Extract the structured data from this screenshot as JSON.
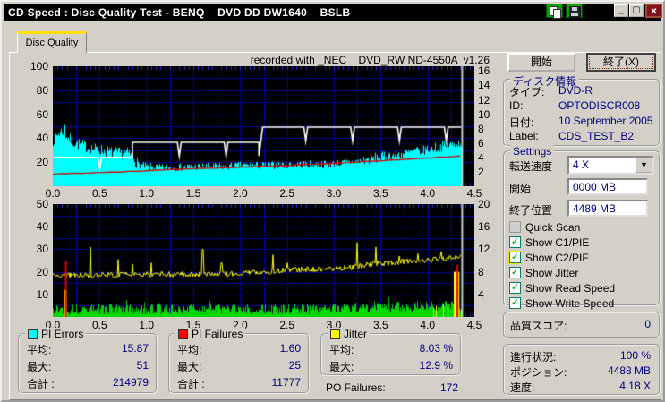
{
  "window": {
    "title": "CD Speed : Disc Quality Test - BENQ    DVD DD DW1640    BSLB",
    "minimize": "_",
    "maximize": "▢",
    "close": "×"
  },
  "tab": {
    "label": "Disc Quality"
  },
  "header": {
    "recorded_with": "recorded with _NEC    DVD_RW ND-4550A  v1.26"
  },
  "chart_data": [
    {
      "type": "area",
      "name": "pi-errors-and-speed-chart",
      "x_axis": {
        "range": [
          0,
          4.5
        ],
        "ticks": [
          "0.0",
          "0.5",
          "1.0",
          "1.5",
          "2.0",
          "2.5",
          "3.0",
          "3.5",
          "4.0",
          "4.5"
        ]
      },
      "y_left": {
        "range": [
          0,
          100
        ],
        "ticks": [
          100,
          80,
          60,
          40,
          20
        ]
      },
      "y_right": {
        "range": [
          0,
          16.67
        ],
        "ticks": [
          16,
          14,
          12,
          10,
          8,
          6,
          4,
          2
        ],
        "left_units_per_right_unit": 6
      },
      "data_end_x": 4.36,
      "grid": {
        "color": "#0000a0",
        "x_step": 0.25,
        "y_step_left": 10
      },
      "series": [
        {
          "name": "PI Errors",
          "color": "#00ffff",
          "style": "filled-spiky-area",
          "avg": 15.87,
          "max": 51,
          "total": 214979,
          "envelope": [
            [
              0,
              38
            ],
            [
              0.05,
              43
            ],
            [
              0.1,
              46
            ],
            [
              0.15,
              41
            ],
            [
              0.2,
              37
            ],
            [
              0.3,
              34
            ],
            [
              0.4,
              31
            ],
            [
              0.5,
              30
            ],
            [
              0.6,
              28
            ],
            [
              0.7,
              27
            ],
            [
              0.8,
              27
            ],
            [
              0.85,
              25
            ],
            [
              0.9,
              18
            ],
            [
              1,
              16
            ],
            [
              1.2,
              15
            ],
            [
              1.5,
              16
            ],
            [
              1.8,
              16
            ],
            [
              2,
              17
            ],
            [
              2.3,
              17
            ],
            [
              2.6,
              18
            ],
            [
              2.9,
              18
            ],
            [
              3.1,
              19
            ],
            [
              3.3,
              21
            ],
            [
              3.5,
              24
            ],
            [
              3.7,
              26
            ],
            [
              3.9,
              29
            ],
            [
              4.1,
              32
            ],
            [
              4.25,
              34
            ],
            [
              4.36,
              36
            ]
          ],
          "max_spike": {
            "x": 0.12,
            "value": 51
          }
        },
        {
          "name": "Write Speed",
          "color": "#ffffff",
          "style": "step-line",
          "unit": "X",
          "segments": [
            {
              "from": 0,
              "to": 0.85,
              "speed_x": 4
            },
            {
              "from": 0.85,
              "to": 2.2,
              "speed_x": 6.1
            },
            {
              "from": 2.2,
              "to": 4.36,
              "speed_x": 8.2
            }
          ],
          "notches": [
            {
              "x": 0.5,
              "dip_to": 2.5
            },
            {
              "x": 1.35,
              "dip_to": 4.2
            },
            {
              "x": 1.85,
              "dip_to": 4.2
            },
            {
              "x": 2.2,
              "dip_to": 4.2
            },
            {
              "x": 2.7,
              "dip_to": 6.3
            },
            {
              "x": 3.2,
              "dip_to": 6.3
            },
            {
              "x": 3.7,
              "dip_to": 6.3
            },
            {
              "x": 4.2,
              "dip_to": 6.3
            }
          ]
        },
        {
          "name": "Read Speed",
          "color": "#dd0000",
          "style": "line",
          "unit": "X",
          "points": [
            [
              0,
              1.67
            ],
            [
              0.85,
              2.08
            ],
            [
              1.5,
              2.42
            ],
            [
              2.2,
              2.75
            ],
            [
              3,
              3.17
            ],
            [
              3.7,
              3.67
            ],
            [
              4.36,
              4.18
            ]
          ]
        }
      ],
      "end_marker": {
        "x": 4.37,
        "color": "#c8c8c8"
      }
    },
    {
      "type": "bar",
      "name": "pi-failures-and-jitter-chart",
      "x_axis": {
        "range": [
          0,
          4.5
        ],
        "ticks": [
          "0.0",
          "0.5",
          "1.0",
          "1.5",
          "2.0",
          "2.5",
          "3.0",
          "3.5",
          "4.0",
          "4.5"
        ]
      },
      "y_left": {
        "range": [
          0,
          50
        ],
        "ticks": [
          50,
          40,
          30,
          20,
          10
        ]
      },
      "y_right": {
        "range": [
          0,
          20
        ],
        "ticks": [
          20,
          16,
          12,
          8,
          4
        ],
        "left_units_per_right_unit": 2.5
      },
      "data_end_x": 4.36,
      "grid": {
        "color": "#0000a0",
        "x_step": 0.25,
        "y_step_left": 5
      },
      "series": [
        {
          "name": "PI Failures",
          "color": "#00d800",
          "style": "spiky-bars",
          "avg": 1.6,
          "max": 25,
          "total": 11777,
          "typical_height_left_units": [
            1,
            9
          ]
        },
        {
          "name": "Jitter",
          "color": "#ffff00",
          "style": "noisy-line",
          "unit": "%",
          "avg_pct": 8.03,
          "max_pct": 12.9,
          "baseline": [
            [
              0,
              18.3
            ],
            [
              0.5,
              18.6
            ],
            [
              1,
              18.8
            ],
            [
              1.5,
              19
            ],
            [
              2,
              19.3
            ],
            [
              2.3,
              20
            ],
            [
              2.6,
              21
            ],
            [
              3,
              21.3
            ],
            [
              3.2,
              22
            ],
            [
              3.4,
              23.5
            ],
            [
              3.6,
              24
            ],
            [
              3.8,
              24.8
            ],
            [
              4,
              25.2
            ],
            [
              4.2,
              26
            ],
            [
              4.36,
              26.3
            ]
          ],
          "spikes": [
            [
              0.4,
              31
            ],
            [
              0.7,
              25.5
            ],
            [
              0.85,
              23.5
            ],
            [
              1.05,
              24
            ],
            [
              1.6,
              30
            ],
            [
              1.8,
              24
            ],
            [
              2.35,
              27.5
            ],
            [
              2.5,
              24
            ],
            [
              3.25,
              33
            ],
            [
              3.45,
              31
            ],
            [
              3.7,
              27
            ],
            [
              3.9,
              28
            ],
            [
              4.15,
              29
            ]
          ],
          "base_bars": [
            [
              0.13,
              12
            ]
          ],
          "end_column": {
            "from": 4.28,
            "to": 4.34,
            "height": 20
          }
        },
        {
          "name": "PO Failures",
          "color": "#dd0000",
          "style": "vertical-spikes",
          "total": 172,
          "spikes": [
            [
              0.13,
              25
            ],
            [
              4.31,
              23
            ]
          ]
        }
      ],
      "end_marker": {
        "x": 4.37,
        "color": "#c8c8c8"
      }
    }
  ],
  "stats": {
    "pi_errors": {
      "legend": "PI Errors",
      "color": "#00ffff",
      "avg_label": "平均:",
      "avg": "15.87",
      "max_label": "最大:",
      "max": "51",
      "total_label": "合計 :",
      "total": "214979"
    },
    "pi_failures": {
      "legend": "PI Failures",
      "color": "#ff0000",
      "avg_label": "平均:",
      "avg": "1.60",
      "max_label": "最大:",
      "max": "25",
      "total_label": "合計 :",
      "total": "11777"
    },
    "jitter": {
      "legend": "Jitter",
      "color": "#ffff00",
      "avg_label": "平均:",
      "avg": "8.03 %",
      "max_label": "最大:",
      "max": "12.9 %"
    },
    "po_failures": {
      "label": "PO Failures:",
      "value": "172"
    }
  },
  "sidebar": {
    "start_button": "開始",
    "exit_button": "終了(X)",
    "disc_info": {
      "title": "ディスク情報",
      "type_label": "タイプ:",
      "type": "DVD-R",
      "id_label": "ID:",
      "id": "OPTODISCR008",
      "date_label": "日付:",
      "date": "10 September 2005",
      "label_label": "Label:",
      "label": "CDS_TEST_B2"
    },
    "settings": {
      "title": "Settings",
      "speed_label": "転送速度",
      "speed_value": "4 X",
      "start_label": "開始",
      "start_value": "0000 MB",
      "end_label": "終了位置",
      "end_value": "4489 MB",
      "checkboxes": [
        {
          "label": "Quick Scan",
          "checked": false,
          "enabled": false,
          "focused": false
        },
        {
          "label": "Show C1/PIE",
          "checked": true,
          "enabled": true,
          "focused": false
        },
        {
          "label": "Show C2/PIF",
          "checked": true,
          "enabled": true,
          "focused": true
        },
        {
          "label": "Show Jitter",
          "checked": true,
          "enabled": true,
          "focused": false
        },
        {
          "label": "Show Read Speed",
          "checked": true,
          "enabled": true,
          "focused": false
        },
        {
          "label": "Show Write Speed",
          "checked": true,
          "enabled": true,
          "focused": false
        }
      ]
    },
    "quality": {
      "label": "品質スコア:",
      "value": "0"
    },
    "progress": {
      "label": "進行状況:",
      "value": "100 %",
      "pos_label": "ポジション:",
      "pos_value": "4488 MB",
      "speed_label": "速度:",
      "speed_value": "4.18 X"
    }
  }
}
